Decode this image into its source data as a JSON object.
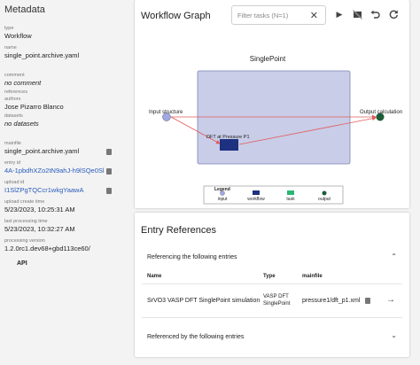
{
  "sidebar": {
    "title": "Metadata",
    "fields": {
      "type": {
        "label": "type",
        "value": "Workflow"
      },
      "name": {
        "label": "name",
        "value": "single_point.archive.yaml"
      },
      "comment": {
        "label": "comment",
        "value": "no comment"
      },
      "references": {
        "label": "references"
      },
      "authors": {
        "label": "authors",
        "value": "Jose Pizarro Blanco"
      },
      "datasets": {
        "label": "datasets",
        "value": "no datasets"
      },
      "mainfile": {
        "label": "mainfile",
        "value": "single_point.archive.yaml"
      },
      "entry_id": {
        "label": "entry id",
        "value": "4A-1pbdhXZo2tN9ahJ-h9lSQe0Sl"
      },
      "upload_id": {
        "label": "upload id",
        "value": "I1SlZPgTQCcr1wkgYaawA"
      },
      "upload_create_time": {
        "label": "upload create time",
        "value": "5/23/2023, 10:25:31 AM"
      },
      "last_processing_time": {
        "label": "last processing time",
        "value": "5/23/2023, 10:32:27 AM"
      },
      "processing_version": {
        "label": "processing version",
        "value": "1.2.0rc1.dev68+gbd113ce60/"
      }
    },
    "api_label": "API"
  },
  "graph": {
    "title": "Workflow Graph",
    "filter_placeholder": "Filter tasks (N=1)",
    "node_title": "SinglePoint",
    "input_label": "Input structure",
    "output_label": "Output calculation",
    "task_label": "DFT at Pressure P1",
    "legend": {
      "title": "Legend",
      "items": [
        {
          "label": "input",
          "color": "#9fa7e6"
        },
        {
          "label": "workflow",
          "color": "#1e3180"
        },
        {
          "label": "task",
          "color": "#2bb673"
        },
        {
          "label": "output",
          "color": "#1d5c36"
        }
      ]
    },
    "colors": {
      "container": "#c9cde8",
      "container_border": "#7b84b5",
      "arrow": "#e05a5a"
    }
  },
  "refs": {
    "title": "Entry References",
    "section1": "Referencing the following entries",
    "columns": {
      "name": "Name",
      "type": "Type",
      "mainfile": "mainfile"
    },
    "row": {
      "name": "SrVO3 VASP DFT SinglePoint simulation",
      "type_line1": "VASP DFT",
      "type_line2": "SinglePoint",
      "mainfile": "pressure1/dft_p1.xml"
    },
    "section2": "Referenced by the following entries"
  }
}
